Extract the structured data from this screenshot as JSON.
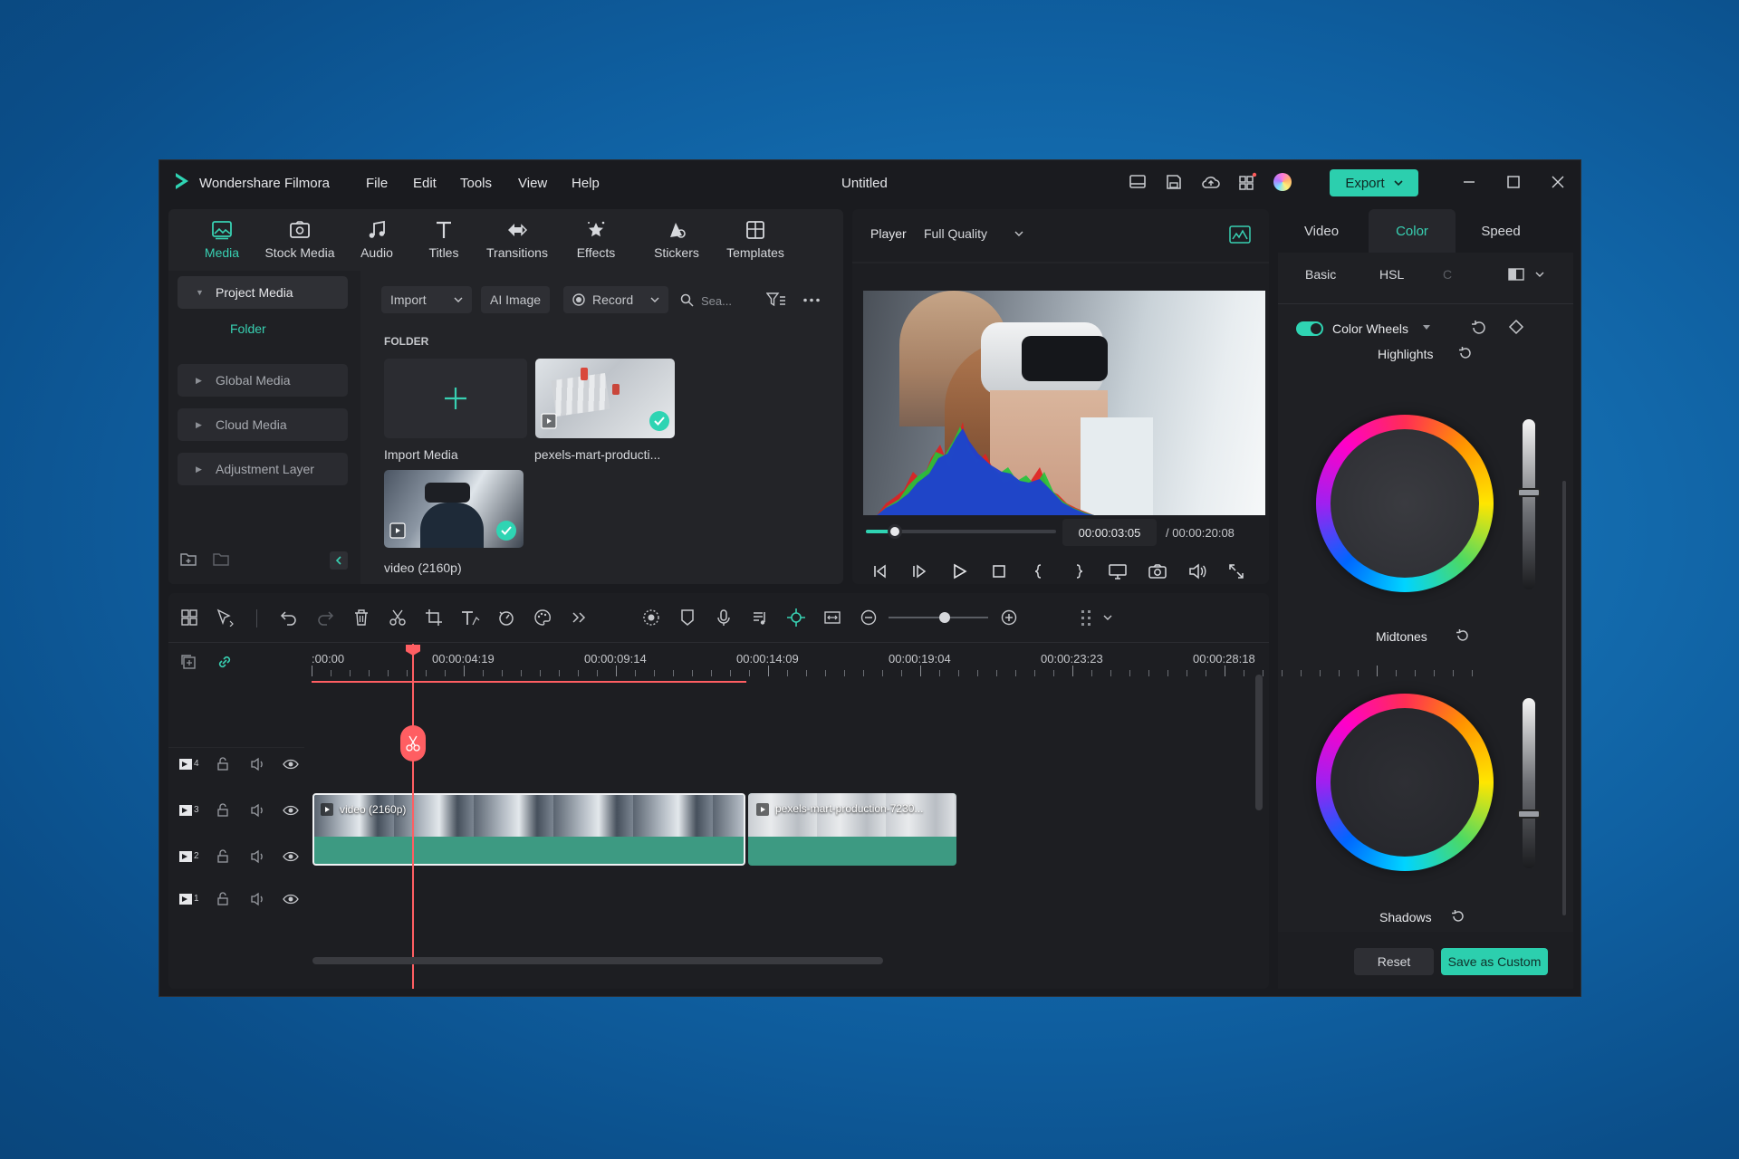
{
  "app": {
    "name": "Wondershare Filmora",
    "doc_title": "Untitled",
    "export_label": "Export"
  },
  "menu": [
    "File",
    "Edit",
    "Tools",
    "View",
    "Help"
  ],
  "tabs": [
    {
      "label": "Media",
      "icon": "media-icon"
    },
    {
      "label": "Stock Media",
      "icon": "stock-media-icon"
    },
    {
      "label": "Audio",
      "icon": "music-note-icon"
    },
    {
      "label": "Titles",
      "icon": "text-t-icon"
    },
    {
      "label": "Transitions",
      "icon": "transitions-icon"
    },
    {
      "label": "Effects",
      "icon": "effects-star-icon"
    },
    {
      "label": "Stickers",
      "icon": "sticker-icon"
    },
    {
      "label": "Templates",
      "icon": "templates-grid-icon"
    }
  ],
  "sidebar": {
    "project_media": "Project Media",
    "folder": "Folder",
    "items": [
      "Global Media",
      "Cloud Media",
      "Adjustment Layer"
    ]
  },
  "media_toolbar": {
    "import": "Import",
    "ai_image": "AI Image",
    "record": "Record",
    "search_placeholder": "Sea..."
  },
  "media": {
    "section_label": "FOLDER",
    "import_label": "Import Media",
    "items": [
      {
        "name": "pexels-mart-producti..."
      },
      {
        "name": "video (2160p)"
      }
    ]
  },
  "player": {
    "label": "Player",
    "quality": "Full Quality",
    "current_time": "00:00:03:05",
    "total_time": "/ 00:00:20:08",
    "progress": 0.15
  },
  "right_panel": {
    "tabs": [
      "Video",
      "Color",
      "Speed"
    ],
    "active_tab": "Color",
    "subtabs": [
      "Basic",
      "HSL",
      "C"
    ],
    "color_wheels_label": "Color Wheels",
    "highlights": "Highlights",
    "midtones": "Midtones",
    "shadows": "Shadows",
    "reset": "Reset",
    "save_custom": "Save as Custom",
    "highlight_level": 0.57,
    "midtone_level": 0.32
  },
  "timeline": {
    "ruler": [
      ":00:00",
      "00:00:04:19",
      "00:00:09:14",
      "00:00:14:09",
      "00:00:19:04",
      "00:00:23:23",
      "00:00:28:18"
    ],
    "tracks": [
      "4",
      "3",
      "2",
      "1"
    ],
    "clips": [
      {
        "name": "video (2160p)"
      },
      {
        "name": "pexels-mart-production-7230..."
      }
    ]
  },
  "colors": {
    "accent": "#38d0b2",
    "export_bg": "#2ccfae",
    "playhead": "#ff5e62",
    "clip_green": "#3d9a82"
  }
}
